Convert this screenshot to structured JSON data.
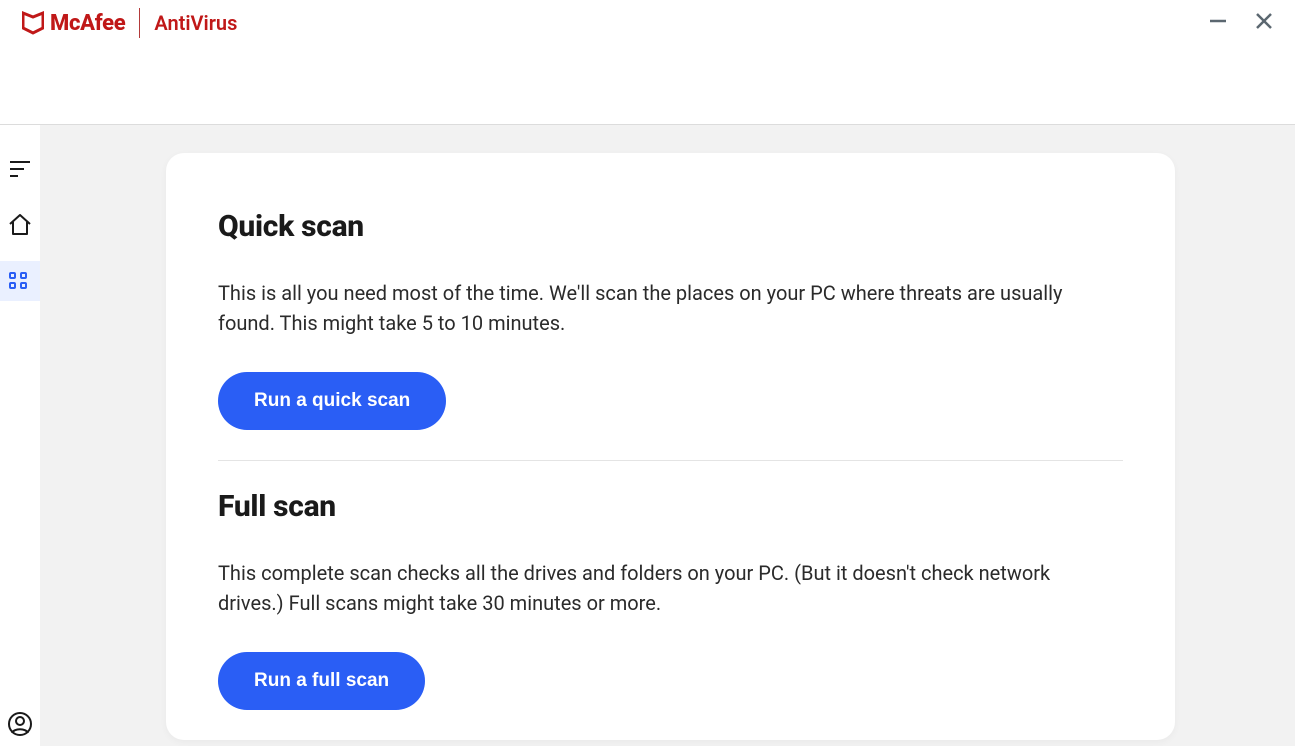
{
  "brand": {
    "name": "McAfee",
    "product": "AntiVirus"
  },
  "scan": {
    "quick": {
      "title": "Quick scan",
      "desc": "This is all you need most of the time. We'll scan the places on your PC where threats are usually found. This might take 5 to 10 minutes.",
      "button": "Run a quick scan"
    },
    "full": {
      "title": "Full scan",
      "desc": "This complete scan checks all the drives and folders on your PC. (But it doesn't check network drives.) Full scans might take 30 minutes or more.",
      "button": "Run a full scan"
    }
  }
}
